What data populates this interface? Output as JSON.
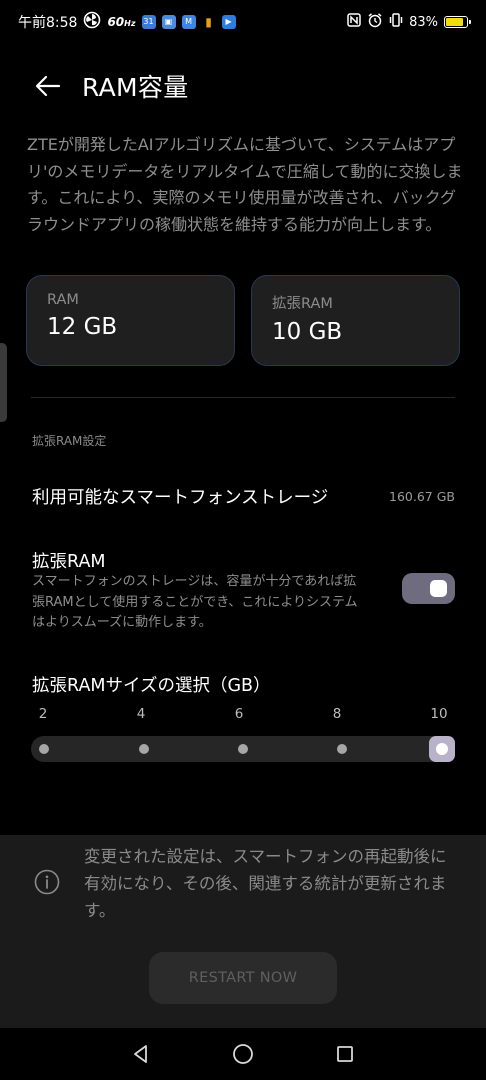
{
  "status_bar": {
    "time": "午前8:58",
    "refresh_rate": "60",
    "refresh_unit": "Hz",
    "battery_percent": "83%",
    "app_icons": [
      {
        "name": "calendar-app-icon",
        "glyph": "31",
        "color": "#3d7bd9"
      },
      {
        "name": "contacts-app-icon",
        "glyph": "▣",
        "color": "#4a8ce0"
      },
      {
        "name": "gmail-app-icon",
        "glyph": "M",
        "color": "#3f86e0"
      },
      {
        "name": "battery-saver-icon",
        "glyph": "▮",
        "color": "#e8a017"
      },
      {
        "name": "play-store-icon",
        "glyph": "▶",
        "color": "#2f7de0"
      }
    ]
  },
  "header": {
    "title": "RAM容量"
  },
  "description": "ZTEが開発したAIアルゴリズムに基づいて、システムはアプリ'のメモリデータをリアルタイムで圧縮して動的に交換します。これにより、実際のメモリ使用量が改善され、バックグラウンドアプリの稼働状態を維持する能力が向上します。",
  "cards": {
    "ram": {
      "label": "RAM",
      "value": "12 GB"
    },
    "extended": {
      "label": "拡張RAM",
      "value": "10 GB"
    }
  },
  "settings": {
    "section_label": "拡張RAM設定",
    "storage_title": "利用可能なスマートフォンストレージ",
    "storage_value": "160.67 GB",
    "extended_title": "拡張RAM",
    "extended_desc": "スマートフォンのストレージは、容量が十分であれば拡張RAMとして使用することができ、これによりシステムはよりスムーズに動作します。",
    "extended_enabled": true,
    "size_title": "拡張RAMサイズの選択（GB）",
    "size_options": [
      "2",
      "4",
      "6",
      "8",
      "10"
    ],
    "selected_size": "10"
  },
  "notice": {
    "text": "変更された設定は、スマートフォンの再起動後に有効になり、その後、関連する統計が更新されます。",
    "restart_label": "RESTART NOW"
  },
  "colors": {
    "accent_toggle": "#6f6c80",
    "slider_thumb": "#b8b3c9",
    "card_border": "#243a52"
  }
}
